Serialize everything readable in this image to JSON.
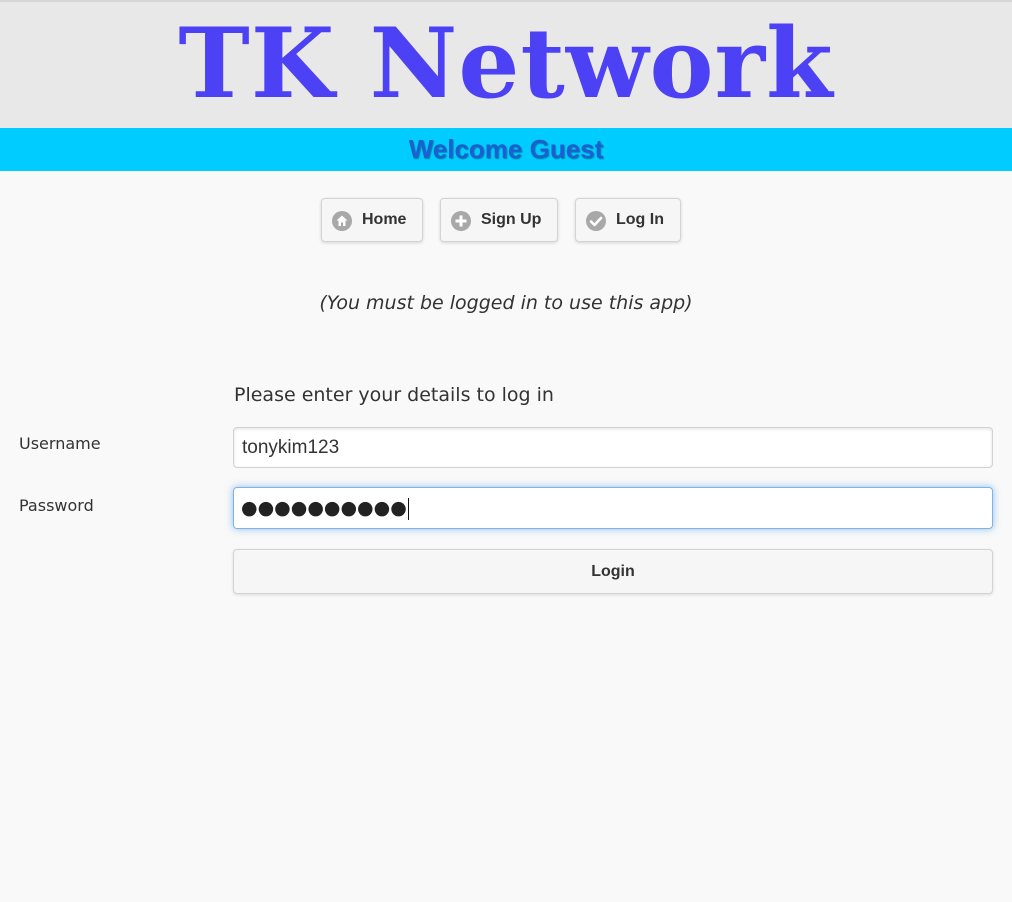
{
  "header": {
    "site_title": "TK Network",
    "welcome_text": "Welcome Guest"
  },
  "nav": {
    "buttons": [
      {
        "label": "Home",
        "icon": "home-icon"
      },
      {
        "label": "Sign Up",
        "icon": "plus-icon"
      },
      {
        "label": "Log In",
        "icon": "check-icon"
      }
    ]
  },
  "main": {
    "notice": "(You must be logged in to use this app)",
    "form": {
      "heading": "Please enter your details to log in",
      "username_label": "Username",
      "username_value": "tonykim123",
      "password_label": "Password",
      "password_masked": "●●●●●●●●●●",
      "submit_label": "Login"
    }
  },
  "colors": {
    "title": "#4d41f5",
    "welcome_bar": "#00ccff",
    "welcome_text": "#1b5fd0",
    "header_bg": "#e8e8e8",
    "page_bg": "#f9f9f9",
    "icon_gray": "#a8a8a8",
    "focus_glow": "#388ce6"
  }
}
